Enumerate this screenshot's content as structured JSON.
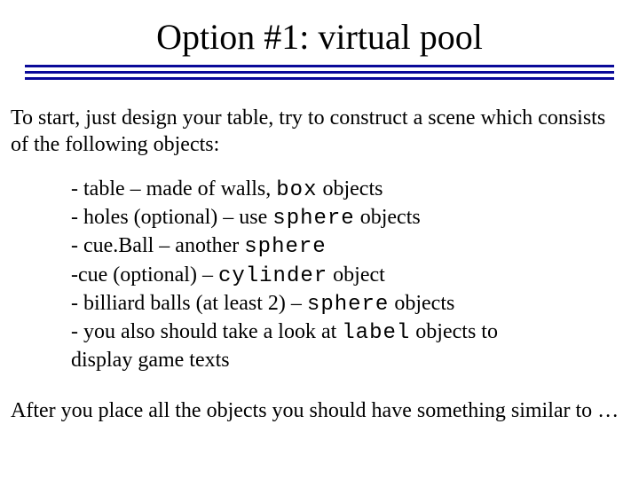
{
  "title": "Option #1:  virtual pool",
  "intro": "To start, just design your table, try to construct a scene which consists of the following objects:",
  "items": [
    {
      "pre": "- table – made of walls, ",
      "code": "box",
      "post": " objects"
    },
    {
      "pre": "- holes (optional) –  use ",
      "code": "sphere",
      "post": " objects"
    },
    {
      "pre": "- cue.Ball – another ",
      "code": "sphere",
      "post": ""
    },
    {
      "pre": "-cue (optional) – ",
      "code": "cylinder",
      "post": " object"
    },
    {
      "pre": "- billiard balls (at least 2) – ",
      "code": "sphere",
      "post": " objects"
    },
    {
      "pre": "- you also should take a look at ",
      "code": "label",
      "post": " objects to display game texts"
    }
  ],
  "outro": "After you place all the objects you should have something similar to …"
}
